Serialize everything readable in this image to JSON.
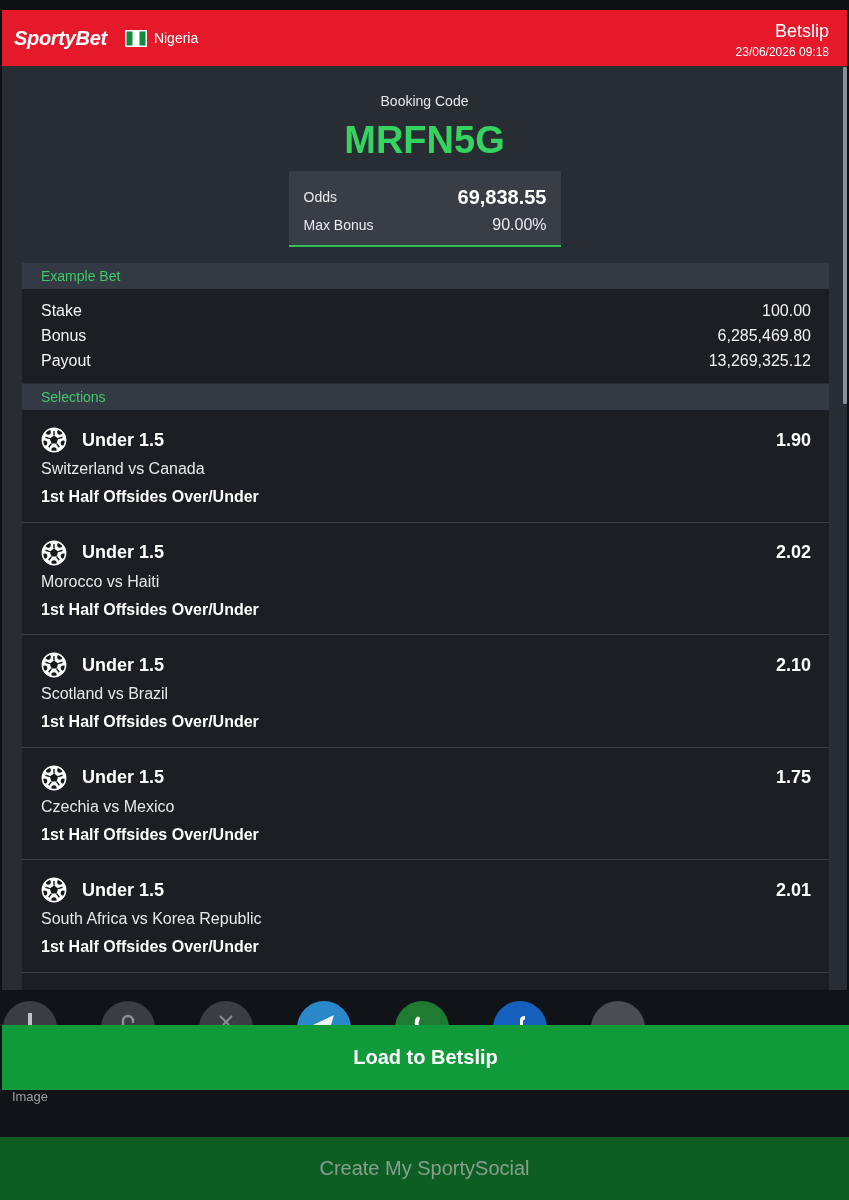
{
  "header": {
    "logo": "SportyBet",
    "country": "Nigeria",
    "title": "Betslip",
    "datetime": "23/06/2026 09:18"
  },
  "booking": {
    "label": "Booking Code",
    "code": "MRFN5G",
    "odds_label": "Odds",
    "odds": "69,838.55",
    "max_bonus_label": "Max Bonus",
    "max_bonus": "90.00%"
  },
  "example_bet": {
    "title": "Example Bet",
    "rows": [
      {
        "label": "Stake",
        "value": "100.00"
      },
      {
        "label": "Bonus",
        "value": "6,285,469.80"
      },
      {
        "label": "Payout",
        "value": "13,269,325.12"
      }
    ]
  },
  "selections": {
    "title": "Selections",
    "items": [
      {
        "pick": "Under 1.5",
        "odds": "1.90",
        "match": "Switzerland vs Canada",
        "market": "1st Half Offsides Over/Under"
      },
      {
        "pick": "Under 1.5",
        "odds": "2.02",
        "match": "Morocco vs Haiti",
        "market": "1st Half Offsides Over/Under"
      },
      {
        "pick": "Under 1.5",
        "odds": "2.10",
        "match": "Scotland vs Brazil",
        "market": "1st Half Offsides Over/Under"
      },
      {
        "pick": "Under 1.5",
        "odds": "1.75",
        "match": "Czechia vs Mexico",
        "market": "1st Half Offsides Over/Under"
      },
      {
        "pick": "Under 1.5",
        "odds": "2.01",
        "match": "South Africa vs Korea Republic",
        "market": "1st Half Offsides Over/Under"
      }
    ]
  },
  "share": {
    "buttons": [
      {
        "kind": "image",
        "label": "Image"
      },
      {
        "kind": "link"
      },
      {
        "kind": "x"
      },
      {
        "kind": "telegram"
      },
      {
        "kind": "whatsapp"
      },
      {
        "kind": "facebook"
      },
      {
        "kind": "more"
      }
    ]
  },
  "actions": [
    {
      "label": "Load to Betslip",
      "disabled": false
    },
    {
      "label": "Create My SportySocial",
      "disabled": true
    }
  ]
}
